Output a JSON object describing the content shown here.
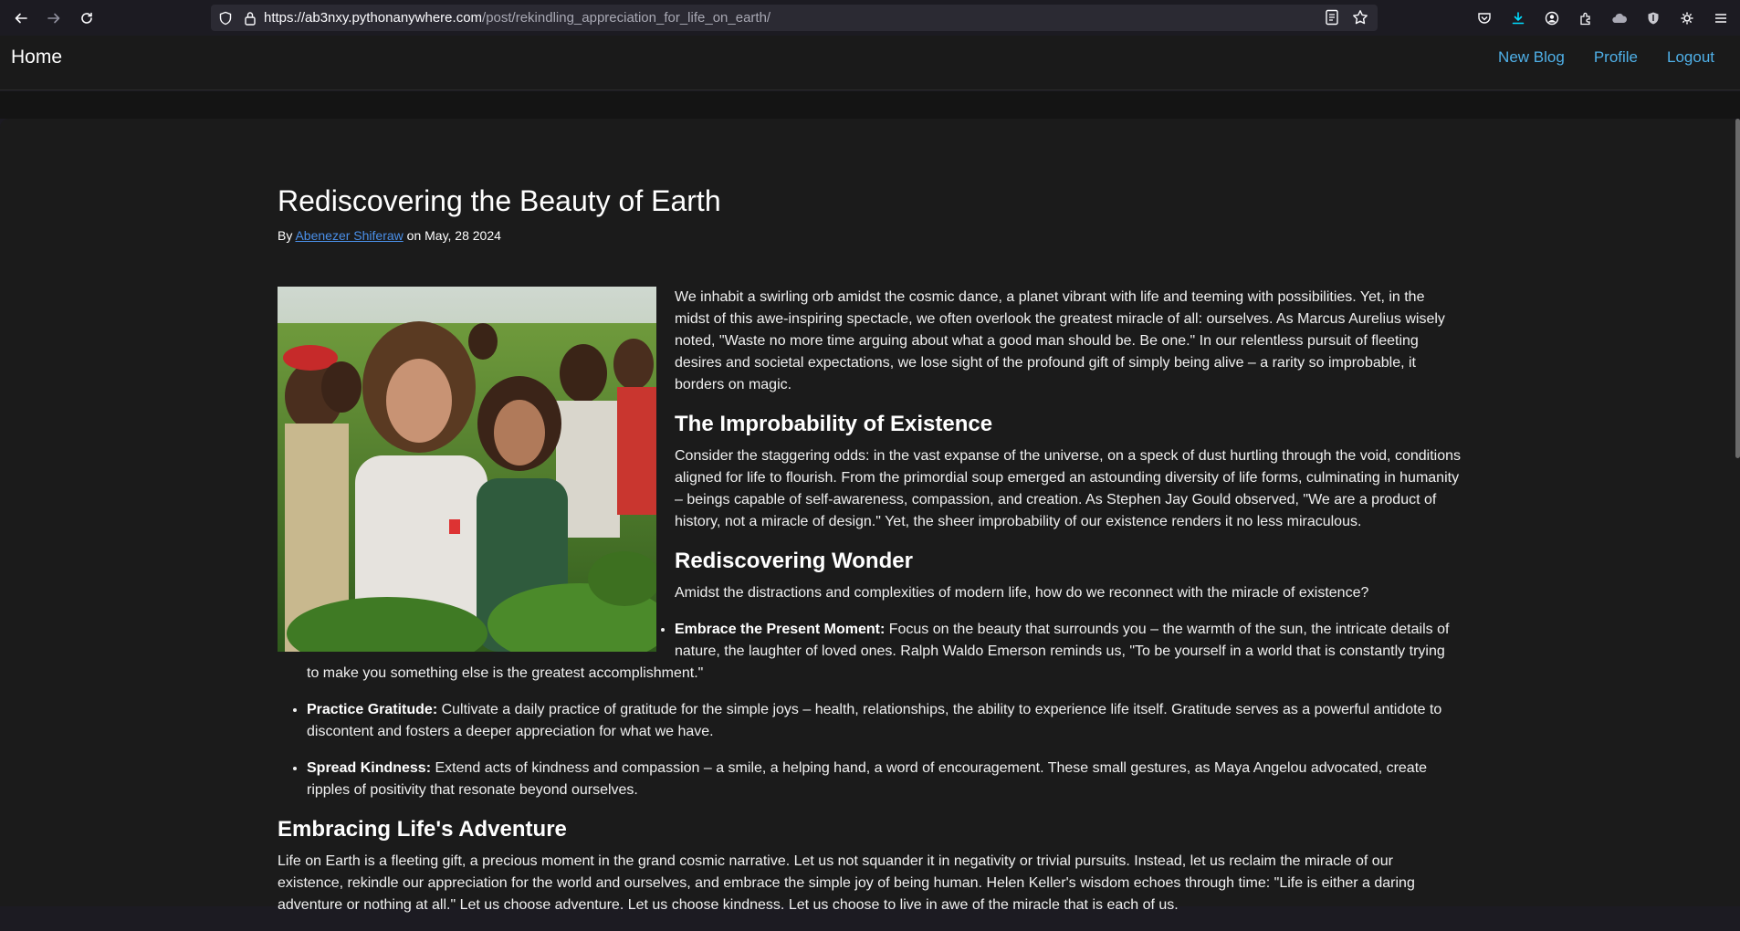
{
  "browser": {
    "url_host": "https://ab3nxy.pythonanywhere.com",
    "url_path": "/post/rekindling_appreciation_for_life_on_earth/"
  },
  "navbar": {
    "brand": "Home",
    "links": [
      "New Blog",
      "Profile",
      "Logout"
    ]
  },
  "post": {
    "title": "Rediscovering the Beauty of Earth",
    "by_prefix": "By",
    "author": "Abenezer Shiferaw",
    "date_text": "on May, 28 2024",
    "intro": "We inhabit a swirling orb amidst the cosmic dance, a planet vibrant with life and teeming with possibilities. Yet, in the midst of this awe-inspiring spectacle, we often overlook the greatest miracle of all: ourselves. As Marcus Aurelius wisely noted, \"Waste no more time arguing about what a good man should be. Be one.\" In our relentless pursuit of fleeting desires and societal expectations, we lose sight of the profound gift of simply being alive – a rarity so improbable, it borders on magic.",
    "h_improbability": "The Improbability of Existence",
    "p_improbability": "Consider the staggering odds: in the vast expanse of the universe, on a speck of dust hurtling through the void, conditions aligned for life to flourish. From the primordial soup emerged an astounding diversity of life forms, culminating in humanity – beings capable of self-awareness, compassion, and creation. As Stephen Jay Gould observed, \"We are a product of history, not a miracle of design.\" Yet, the sheer improbability of our existence renders it no less miraculous.",
    "h_wonder": "Rediscovering Wonder",
    "p_wonder": "Amidst the distractions and complexities of modern life, how do we reconnect with the miracle of existence?",
    "list": [
      {
        "label": "Embrace the Present Moment:",
        "text": " Focus on the beauty that surrounds you – the warmth of the sun, the intricate details of nature, the laughter of loved ones. Ralph Waldo Emerson reminds us, \"To be yourself in a world that is constantly trying to make you something else is the greatest accomplishment.\""
      },
      {
        "label": "Practice Gratitude:",
        "text": " Cultivate a daily practice of gratitude for the simple joys – health, relationships, the ability to experience life itself. Gratitude serves as a powerful antidote to discontent and fosters a deeper appreciation for what we have."
      },
      {
        "label": "Spread Kindness:",
        "text": " Extend acts of kindness and compassion – a smile, a helping hand, a word of encouragement. These small gestures, as Maya Angelou advocated, create ripples of positivity that resonate beyond ourselves."
      }
    ],
    "h_adventure": "Embracing Life's Adventure",
    "p_adventure": "Life on Earth is a fleeting gift, a precious moment in the grand cosmic narrative. Let us not squander it in negativity or trivial pursuits. Instead, let us reclaim the miracle of our existence, rekindle our appreciation for the world and ourselves, and embrace the simple joy of being human. Helen Keller's wisdom echoes through time: \"Life is either a daring adventure or nothing at all.\" Let us choose adventure. Let us choose kindness. Let us choose to live in awe of the miracle that is each of us."
  }
}
